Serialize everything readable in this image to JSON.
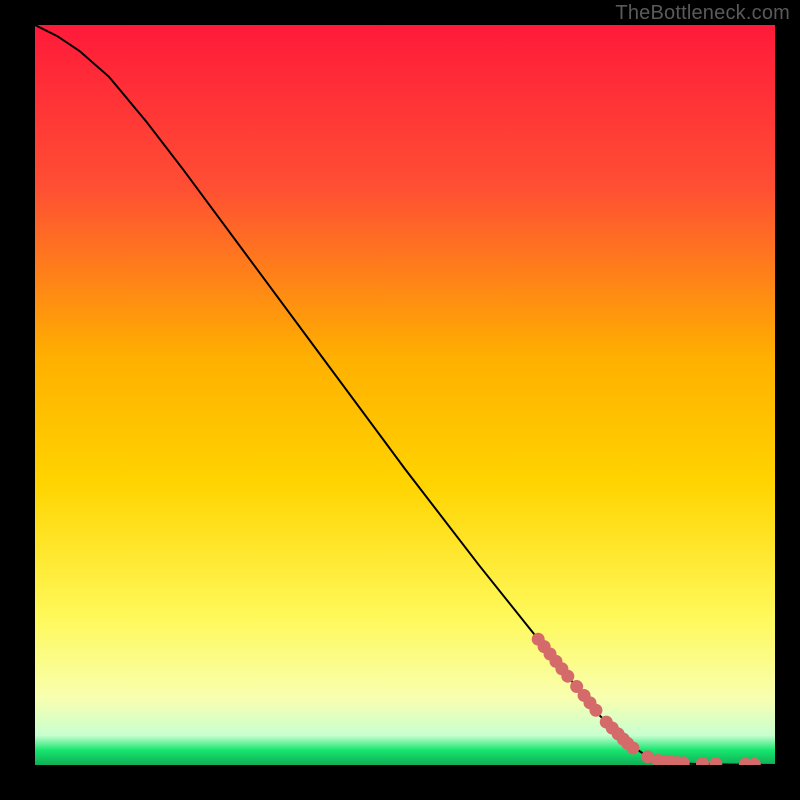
{
  "watermark": "TheBottleneck.com",
  "colors": {
    "background_black": "#000000",
    "gradient_top": "#ff1a3a",
    "gradient_mid_upper": "#ff6a2a",
    "gradient_mid": "#ffd400",
    "gradient_lower": "#fff95a",
    "gradient_pale": "#f8ffb0",
    "gradient_green": "#17e66f",
    "curve_stroke": "#000000",
    "marker_fill": "#d46a6a"
  },
  "chart_data": {
    "type": "line",
    "title": "",
    "xlabel": "",
    "ylabel": "",
    "xlim": [
      0,
      100
    ],
    "ylim": [
      0,
      100
    ],
    "curve": [
      {
        "x": 0,
        "y": 100
      },
      {
        "x": 3,
        "y": 98.5
      },
      {
        "x": 6,
        "y": 96.5
      },
      {
        "x": 10,
        "y": 93
      },
      {
        "x": 15,
        "y": 87
      },
      {
        "x": 20,
        "y": 80.5
      },
      {
        "x": 30,
        "y": 67
      },
      {
        "x": 40,
        "y": 53.5
      },
      {
        "x": 50,
        "y": 40
      },
      {
        "x": 60,
        "y": 27
      },
      {
        "x": 70,
        "y": 14.5
      },
      {
        "x": 76,
        "y": 7
      },
      {
        "x": 80,
        "y": 3
      },
      {
        "x": 83,
        "y": 1
      },
      {
        "x": 86,
        "y": 0.3
      },
      {
        "x": 90,
        "y": 0.1
      },
      {
        "x": 100,
        "y": 0.0
      }
    ],
    "markers": [
      {
        "x": 68.0,
        "y": 17.0
      },
      {
        "x": 68.8,
        "y": 16.0
      },
      {
        "x": 69.6,
        "y": 15.0
      },
      {
        "x": 70.4,
        "y": 14.0
      },
      {
        "x": 71.2,
        "y": 13.0
      },
      {
        "x": 72.0,
        "y": 12.0
      },
      {
        "x": 73.2,
        "y": 10.6
      },
      {
        "x": 74.2,
        "y": 9.4
      },
      {
        "x": 75.0,
        "y": 8.4
      },
      {
        "x": 75.8,
        "y": 7.4
      },
      {
        "x": 77.2,
        "y": 5.8
      },
      {
        "x": 78.0,
        "y": 5.0
      },
      {
        "x": 78.8,
        "y": 4.2
      },
      {
        "x": 79.5,
        "y": 3.5
      },
      {
        "x": 80.1,
        "y": 2.9
      },
      {
        "x": 80.8,
        "y": 2.3
      },
      {
        "x": 82.8,
        "y": 1.1
      },
      {
        "x": 84.2,
        "y": 0.6
      },
      {
        "x": 85.2,
        "y": 0.5
      },
      {
        "x": 86.0,
        "y": 0.4
      },
      {
        "x": 86.8,
        "y": 0.3
      },
      {
        "x": 87.6,
        "y": 0.28
      },
      {
        "x": 90.2,
        "y": 0.2
      },
      {
        "x": 92.0,
        "y": 0.16
      },
      {
        "x": 96.0,
        "y": 0.1
      },
      {
        "x": 97.2,
        "y": 0.08
      }
    ]
  }
}
